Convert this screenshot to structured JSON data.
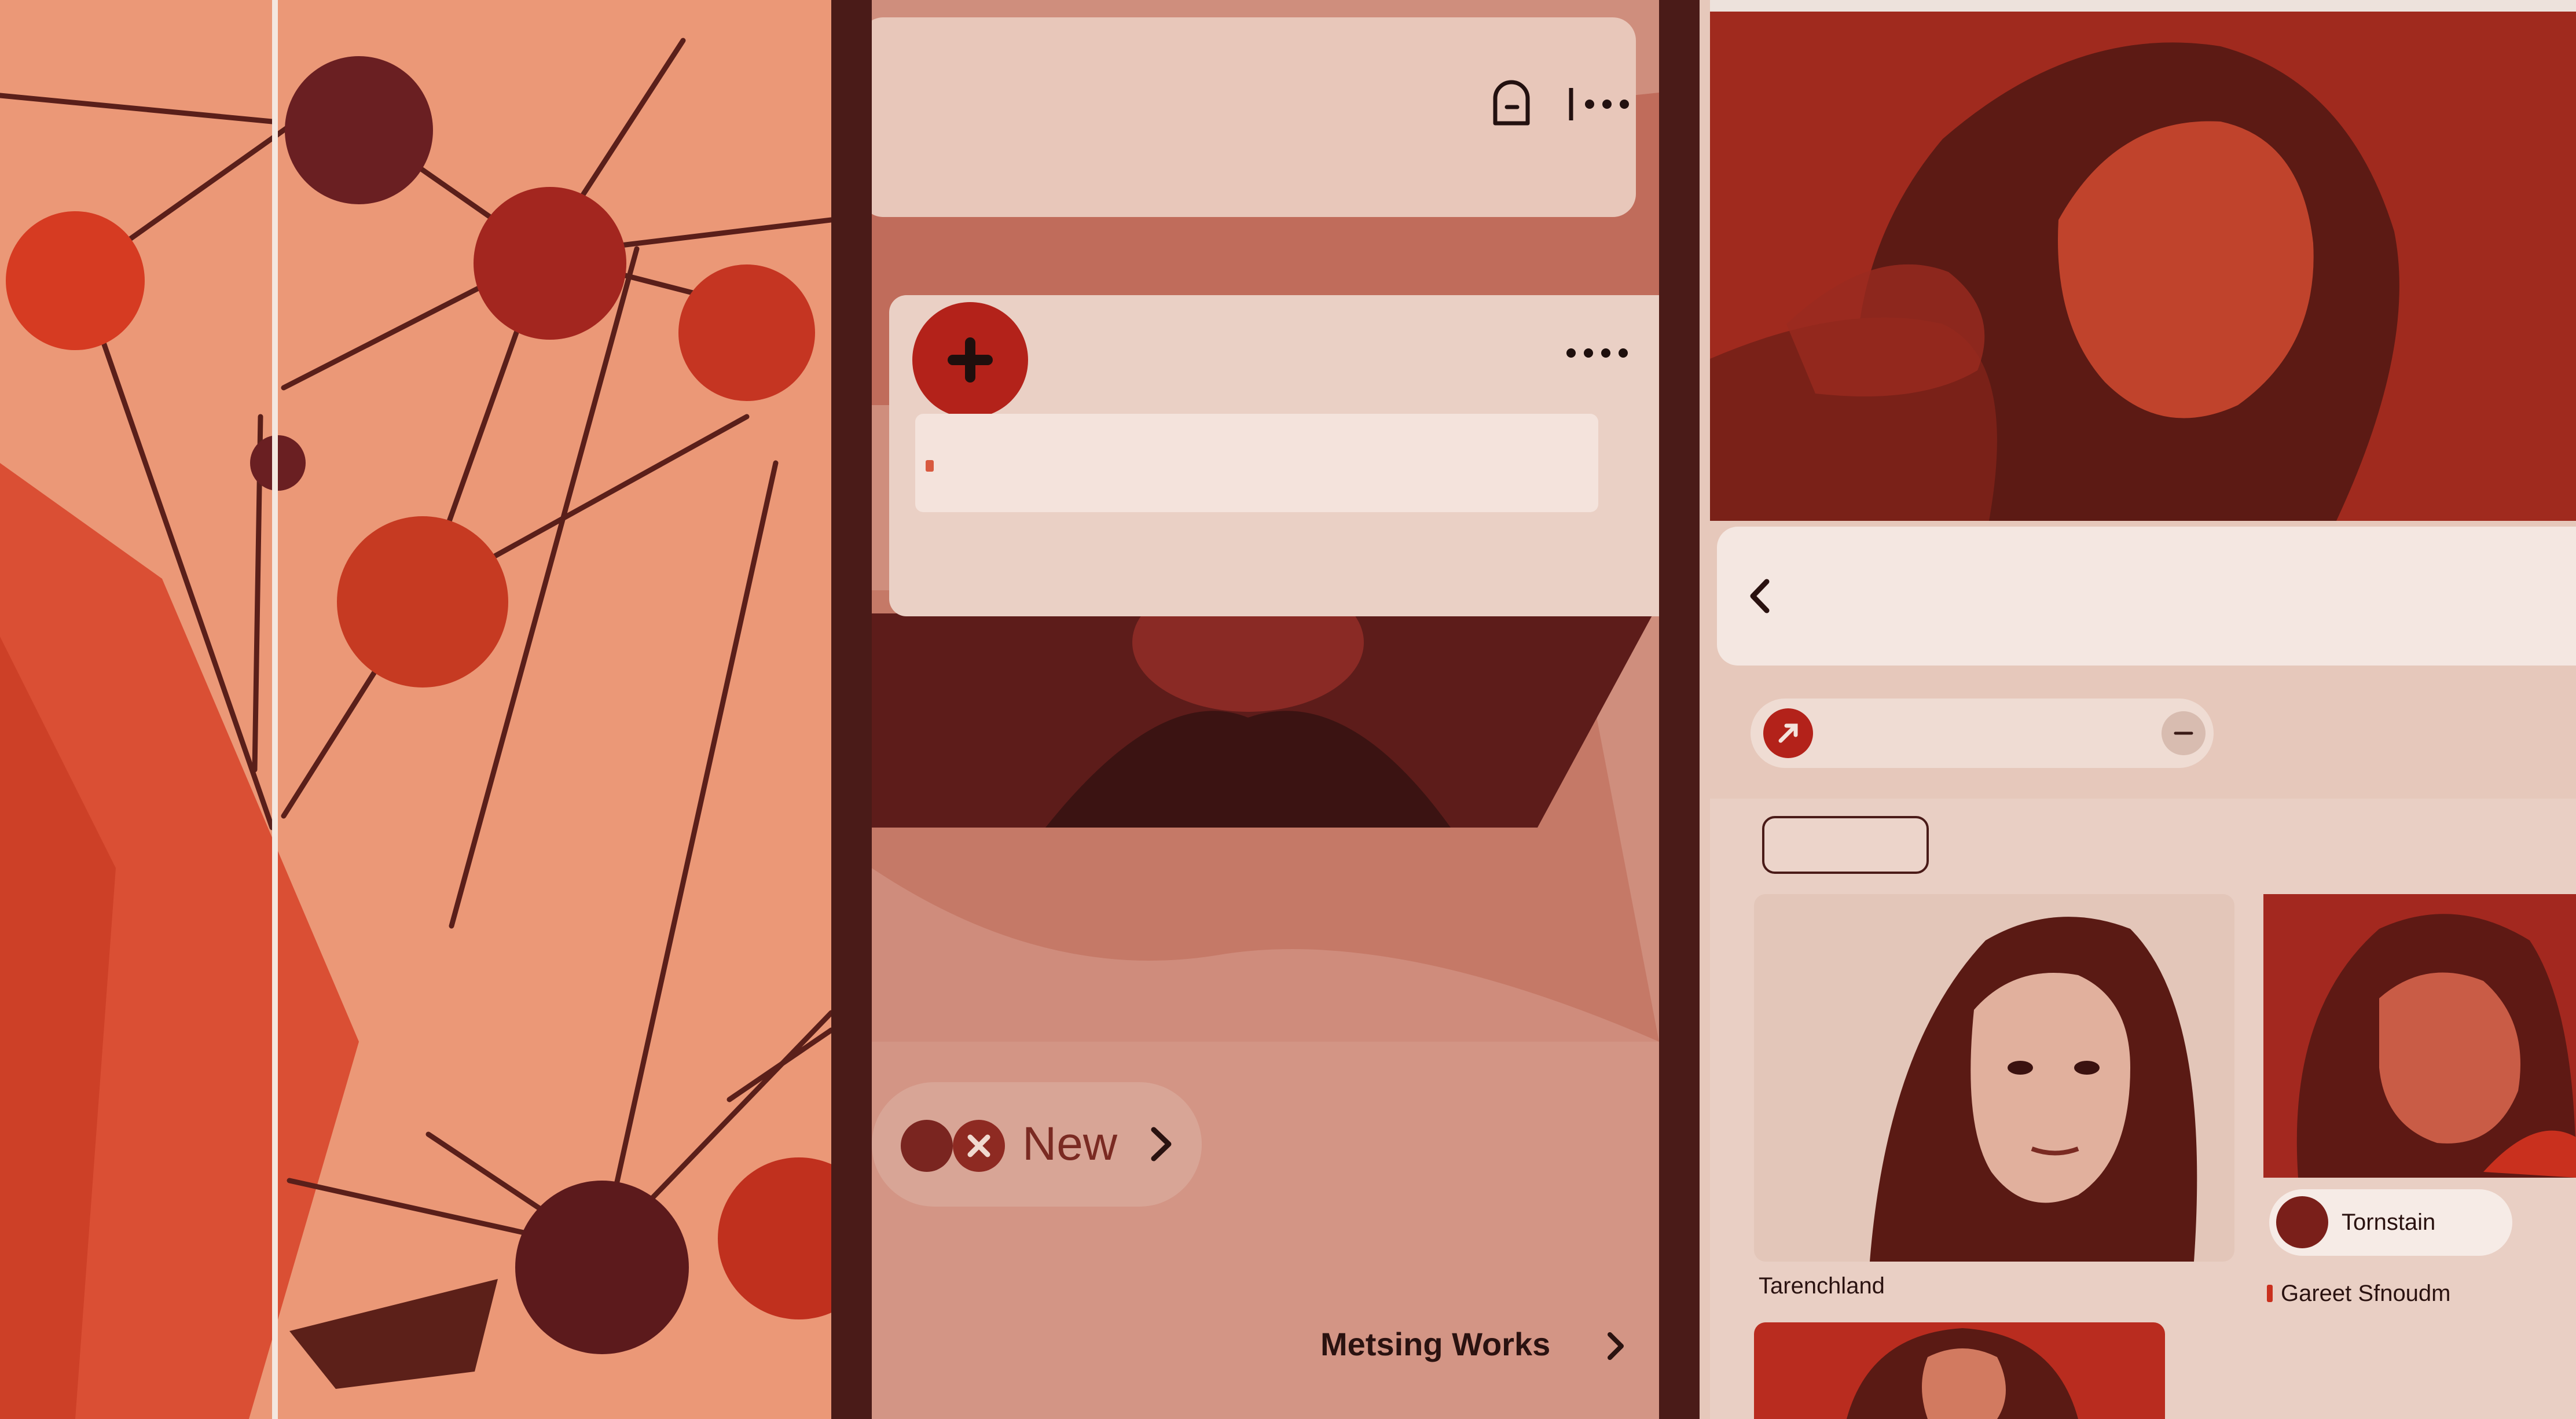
{
  "colors": {
    "panel_left_bg": "#eb9877",
    "panel_mid_bg": "#cf8e7d",
    "panel_right_bg": "#e6c8bb",
    "divider": "#4a1b18",
    "accent_red": "#b3221a",
    "card_light": "#f1ddd4",
    "text_dark": "#2a1210"
  },
  "panel_middle": {
    "top_bar": {
      "icons": [
        "ghost-icon",
        "overflow-menu-icon"
      ]
    },
    "composer": {
      "avatar_icon": "plus-icon",
      "menu_icon": "more-dots-icon"
    },
    "new_chip": {
      "label": "New",
      "icons": [
        "stack-icon",
        "x-badge-icon"
      ],
      "arrow": "chevron-right-icon"
    },
    "works_link": {
      "label": "Metsing Works",
      "arrow": "chevron-right-icon"
    }
  },
  "panel_right": {
    "back_icon": "chevron-left-icon",
    "search": {
      "avatar_icon": "pin-icon",
      "clear_icon": "minus-icon"
    },
    "tiles": [
      {
        "caption": "Tarenchland"
      },
      {
        "badge": "Tornstain",
        "caption": "Gareet Sfnoudm"
      }
    ]
  }
}
